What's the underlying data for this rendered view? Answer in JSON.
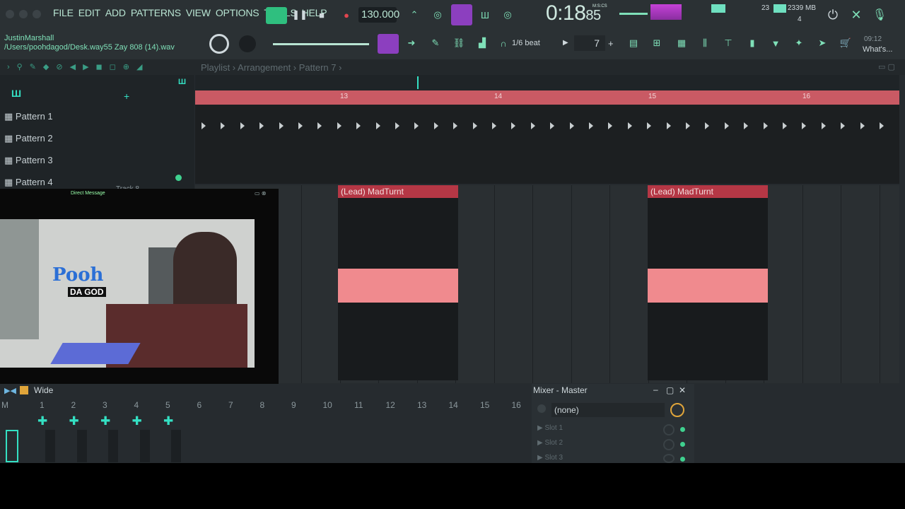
{
  "menu": [
    "FILE",
    "EDIT",
    "ADD",
    "PATTERNS",
    "VIEW",
    "OPTIONS",
    "TOOLS",
    "HELP"
  ],
  "tempo": "130.000",
  "time": "0:18",
  "time_sub": "85",
  "time_label": "M:S:CS",
  "cpu_value": "23",
  "ram_value": "2339 MB",
  "ram_poly": "4",
  "user": "JustinMarshall",
  "filepath": "/Users/poohdagod/Desk.way55 Zay 808 (14).wav",
  "snap": "1/6 beat",
  "pattern_num": "7",
  "news_time": "09:12",
  "news_text": "What's...",
  "breadcrumb": {
    "p1": "Playlist",
    "p2": "Arrangement",
    "p3": "Pattern 7"
  },
  "patterns": [
    "Pattern 1",
    "Pattern 2",
    "Pattern 3",
    "Pattern 4"
  ],
  "track_label": "Track 8",
  "ruler": [
    "13",
    "14",
    "15",
    "16"
  ],
  "clips": [
    {
      "label": "(Lead) MadTurnt"
    },
    {
      "label": "(Lead) MadTurnt"
    }
  ],
  "webcam": {
    "title": "Direct Message",
    "overlay_top": "Pooh",
    "overlay_bottom": "DA GOD"
  },
  "rack": {
    "name": "Wide",
    "label_m": "M",
    "steps": [
      "1",
      "2",
      "3",
      "4",
      "5",
      "6",
      "7",
      "8",
      "9",
      "10",
      "11",
      "12",
      "13",
      "14",
      "15",
      "16"
    ]
  },
  "mixer": {
    "title": "Mixer - Master",
    "input": "(none)",
    "slots": [
      "Slot 1",
      "Slot 2",
      "Slot 3"
    ]
  },
  "colors": {
    "accent": "#34e0c3",
    "clip_head": "#b53745",
    "wave": "#f08a8e",
    "ruler": "#c95a64"
  }
}
